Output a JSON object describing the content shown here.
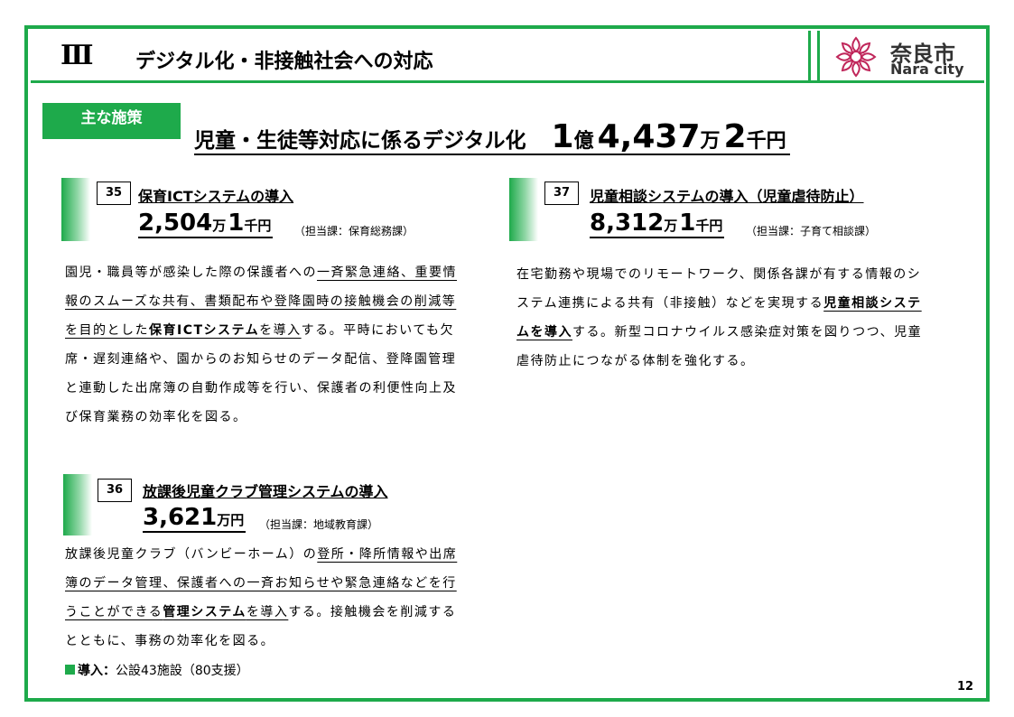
{
  "header": {
    "section_number": "Ⅲ",
    "title": "デジタル化・非接触社会への対応",
    "logo_name": "奈良市",
    "logo_en": "Nara city"
  },
  "colors": {
    "accent": "#1eaa4b"
  },
  "main": {
    "badge": "主な施策",
    "title": "児童・生徒等対応に係るデジタル化",
    "amount": {
      "n1": "1",
      "u1": "億",
      "n2": "4,437",
      "u2": "万",
      "n3": "2",
      "u3": "千円"
    }
  },
  "items": [
    {
      "num": "35",
      "title": "保育ICTシステムの導入",
      "amount": {
        "n1": "2,504",
        "u1": "万",
        "n2": "1",
        "u2": "千円"
      },
      "dept": "（担当課：保育総務課）",
      "body": [
        {
          "t": "園児・職員等が感染した際の保護者への",
          "u": false,
          "b": false
        },
        {
          "t": "一斉緊急連絡、重要情報のスムーズな共有、書類配布や登降園時の接触機会の削減等を目的とした",
          "u": true,
          "b": false
        },
        {
          "t": "保育ICTシステム",
          "u": true,
          "b": true
        },
        {
          "t": "を導入",
          "u": true,
          "b": false
        },
        {
          "t": "する。平時においても欠席・遅刻連絡や、園からのお知らせのデータ配信、登降園管理と連動した出席簿の自動作成等を行い、保護者の利便性向上及び保育業務の効率化を図る。",
          "u": false,
          "b": false
        }
      ]
    },
    {
      "num": "36",
      "title": "放課後児童クラブ管理システムの導入",
      "amount": {
        "n1": "3,621",
        "u1": "万円"
      },
      "dept": "（担当課：地域教育課）",
      "body": [
        {
          "t": "放課後児童クラブ（バンビーホーム）の",
          "u": false,
          "b": false
        },
        {
          "t": "登所・降所情報や出席簿のデータ管理、保護者への一斉お知らせや緊急連絡などを行うことができる",
          "u": true,
          "b": false
        },
        {
          "t": "管理システム",
          "u": true,
          "b": true
        },
        {
          "t": "を導入",
          "u": true,
          "b": false
        },
        {
          "t": "する。接触機会を削減するとともに、事務の効率化を図る。",
          "u": false,
          "b": false
        }
      ],
      "intro_label": "導入：",
      "intro_value": "公設43施設（80支援）"
    },
    {
      "num": "37",
      "title": "児童相談システムの導入（児童虐待防止）",
      "amount": {
        "n1": "8,312",
        "u1": "万",
        "n2": "1",
        "u2": "千円"
      },
      "dept": "（担当課：子育て相談課）",
      "body": [
        {
          "t": "在宅勤務や現場でのリモートワーク、関係各課が有する情報のシステム連携による共有（非接触）などを実現する",
          "u": false,
          "b": false
        },
        {
          "t": "児童相談システムを導入",
          "u": true,
          "b": true
        },
        {
          "t": "する。新型コロナウイルス感染症対策を図りつつ、児童虐待防止につながる体制を強化する。",
          "u": false,
          "b": false
        }
      ]
    }
  ],
  "page_number": "12"
}
